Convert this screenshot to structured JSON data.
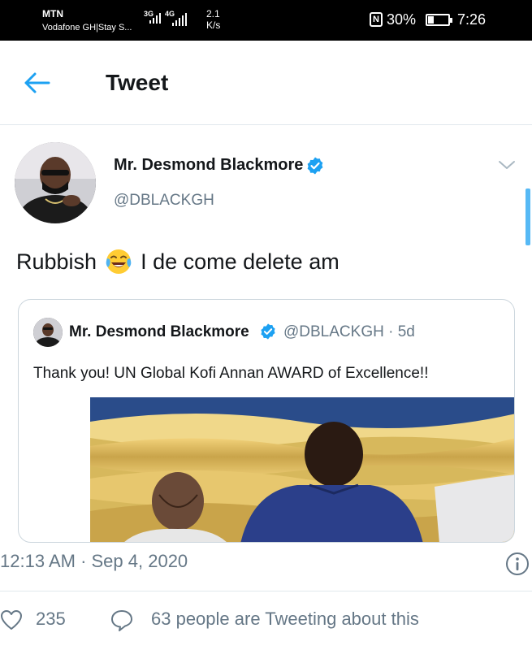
{
  "status_bar": {
    "carrier_top": "MTN",
    "carrier_bottom": "Vodafone GH|Stay S...",
    "signal1_label": "3G",
    "signal2_label": "4G",
    "net_speed_value": "2.1",
    "net_speed_unit": "K/s",
    "nfc_label": "N",
    "battery_percent": "30%",
    "battery_level": 0.3,
    "time": "7:26"
  },
  "header": {
    "back_icon": "arrow-left-icon",
    "title": "Tweet"
  },
  "tweet": {
    "author_name": "Mr. Desmond Blackmore",
    "author_handle": "@DBLACKGH",
    "text_before_emoji": "Rubbish",
    "emoji": "face-with-tears-of-joy",
    "text_after_emoji": "I de come delete am",
    "timestamp": "12:13 AM · Sep 4, 2020",
    "likes": "235",
    "tweeting_about": "63 people are Tweeting about this"
  },
  "quoted_tweet": {
    "author_name": "Mr. Desmond Blackmore",
    "author_handle": "@DBLACKGH · 5d",
    "text": "Thank you! UN Global Kofi Annan AWARD of Excellence!!"
  },
  "colors": {
    "accent": "#1da1f2",
    "secondary_text": "#657786",
    "border": "#e1e8ed"
  }
}
